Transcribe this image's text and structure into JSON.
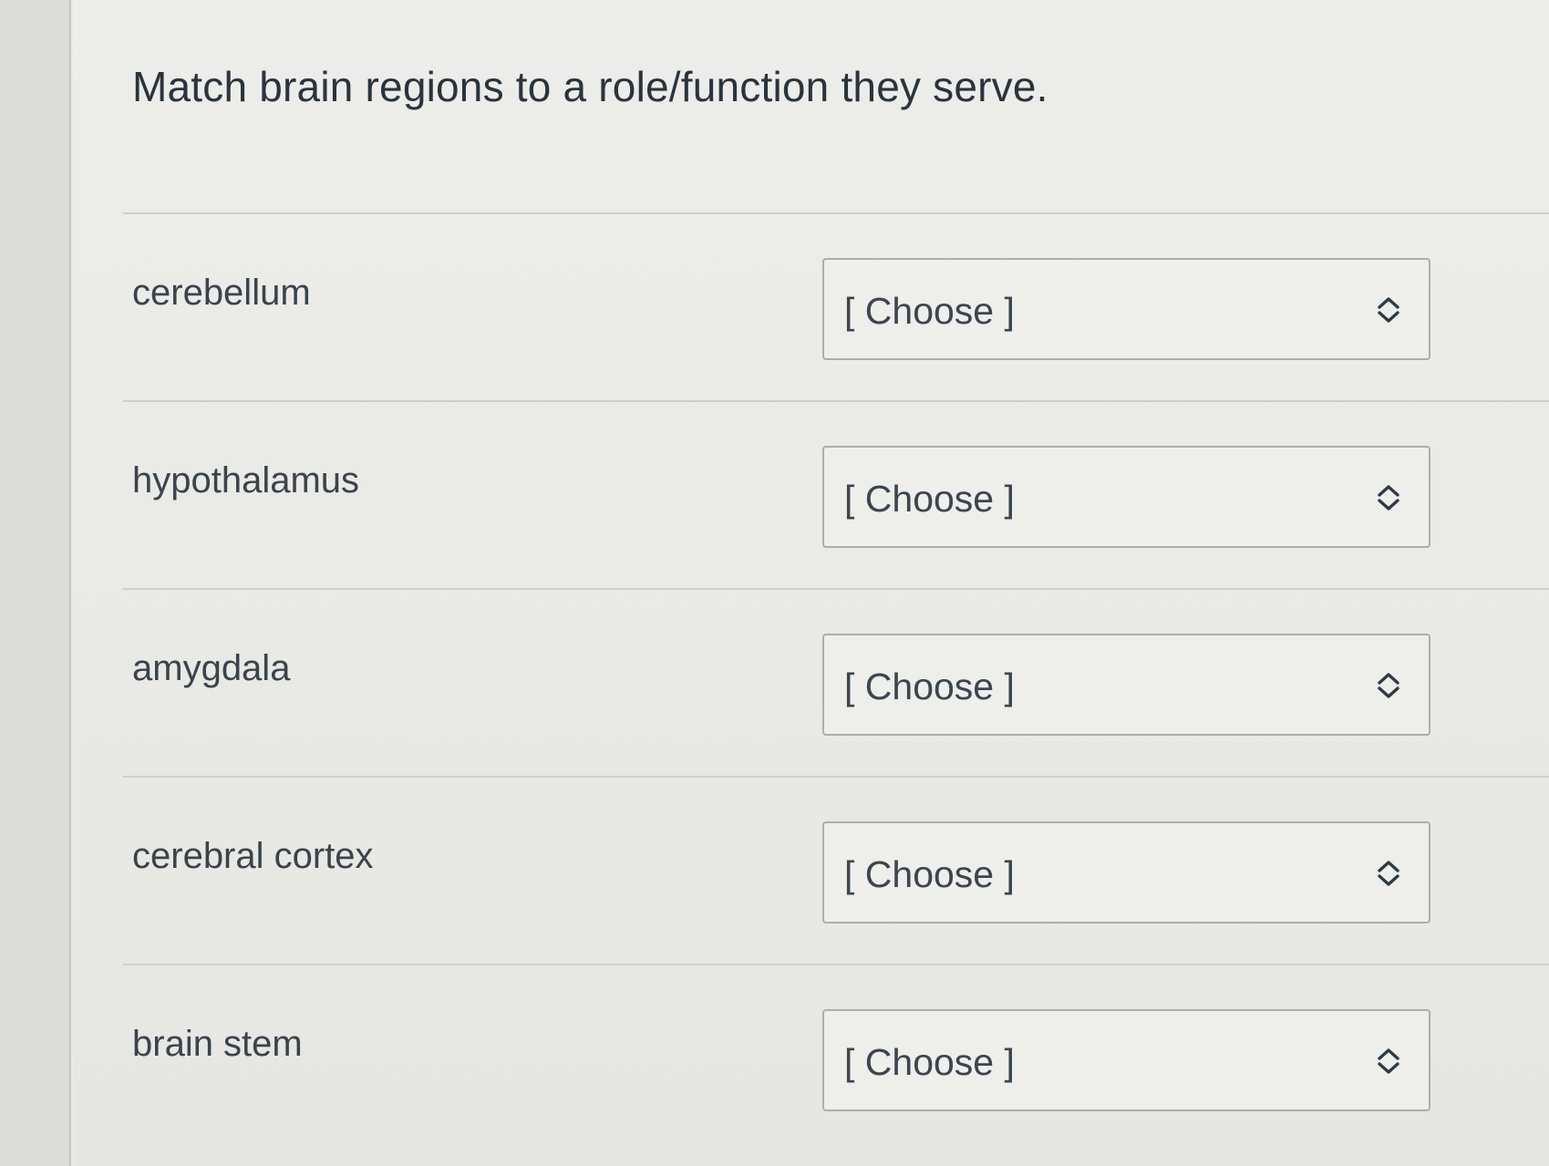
{
  "question": {
    "title": "Match brain regions to a role/function they serve."
  },
  "rows": [
    {
      "label": "cerebellum",
      "select_value": "[ Choose ]"
    },
    {
      "label": "hypothalamus",
      "select_value": "[ Choose ]"
    },
    {
      "label": "amygdala",
      "select_value": "[ Choose ]"
    },
    {
      "label": "cerebral cortex",
      "select_value": "[ Choose ]"
    },
    {
      "label": "brain stem",
      "select_value": "[ Choose ]"
    }
  ],
  "colors": {
    "text": "#2d3b45",
    "select_border": "#a9afb3",
    "divider": "#cfcfcb"
  },
  "icons": {
    "select_indicator": "chevron-up-down-icon"
  }
}
